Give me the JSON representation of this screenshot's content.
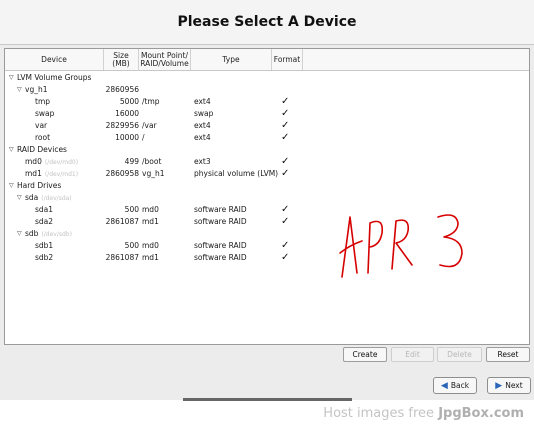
{
  "header": {
    "title": "Please Select A Device"
  },
  "columns": {
    "device": "Device",
    "size_line1": "Size",
    "size_line2": "(MB)",
    "mount_line1": "Mount Point/",
    "mount_line2": "RAID/Volume",
    "type": "Type",
    "format": "Format"
  },
  "rows": [
    {
      "name": "LVM Volume Groups",
      "level": 0,
      "expander": "▽",
      "path": "",
      "size": "",
      "mount": "",
      "type": "",
      "format": false
    },
    {
      "name": "vg_h1",
      "level": 1,
      "expander": "▽",
      "path": "",
      "size": "2860956",
      "mount": "",
      "type": "",
      "format": false
    },
    {
      "name": "tmp",
      "level": 2,
      "expander": "",
      "path": "",
      "size": "5000",
      "mount": "/tmp",
      "type": "ext4",
      "format": true
    },
    {
      "name": "swap",
      "level": 2,
      "expander": "",
      "path": "",
      "size": "16000",
      "mount": "",
      "type": "swap",
      "format": true
    },
    {
      "name": "var",
      "level": 2,
      "expander": "",
      "path": "",
      "size": "2829956",
      "mount": "/var",
      "type": "ext4",
      "format": true
    },
    {
      "name": "root",
      "level": 2,
      "expander": "",
      "path": "",
      "size": "10000",
      "mount": "/",
      "type": "ext4",
      "format": true
    },
    {
      "name": "RAID Devices",
      "level": 0,
      "expander": "▽",
      "path": "",
      "size": "",
      "mount": "",
      "type": "",
      "format": false
    },
    {
      "name": "md0",
      "level": 1,
      "expander": "",
      "path": "(/dev/md0)",
      "size": "499",
      "mount": "/boot",
      "type": "ext3",
      "format": true
    },
    {
      "name": "md1",
      "level": 1,
      "expander": "",
      "path": "(/dev/md1)",
      "size": "2860958",
      "mount": "vg_h1",
      "type": "physical volume (LVM)",
      "format": true
    },
    {
      "name": "Hard Drives",
      "level": 0,
      "expander": "▽",
      "path": "",
      "size": "",
      "mount": "",
      "type": "",
      "format": false
    },
    {
      "name": "sda",
      "level": 1,
      "expander": "▽",
      "path": "(/dev/sda)",
      "size": "",
      "mount": "",
      "type": "",
      "format": false
    },
    {
      "name": "sda1",
      "level": 2,
      "expander": "",
      "path": "",
      "size": "500",
      "mount": "md0",
      "type": "software RAID",
      "format": true
    },
    {
      "name": "sda2",
      "level": 2,
      "expander": "",
      "path": "",
      "size": "2861087",
      "mount": "md1",
      "type": "software RAID",
      "format": true
    },
    {
      "name": "sdb",
      "level": 1,
      "expander": "▽",
      "path": "(/dev/sdb)",
      "size": "",
      "mount": "",
      "type": "",
      "format": false
    },
    {
      "name": "sdb1",
      "level": 2,
      "expander": "",
      "path": "",
      "size": "500",
      "mount": "md0",
      "type": "software RAID",
      "format": true
    },
    {
      "name": "sdb2",
      "level": 2,
      "expander": "",
      "path": "",
      "size": "2861087",
      "mount": "md1",
      "type": "software RAID",
      "format": true
    }
  ],
  "check_glyph": "✓",
  "actions": {
    "create": "Create",
    "edit": "Edit",
    "delete": "Delete",
    "reset": "Reset"
  },
  "nav": {
    "back": "Back",
    "next": "Next"
  },
  "handwriting": "APR 3",
  "watermark": {
    "prefix": "Host images free ",
    "brand": "JpgBox.com"
  }
}
